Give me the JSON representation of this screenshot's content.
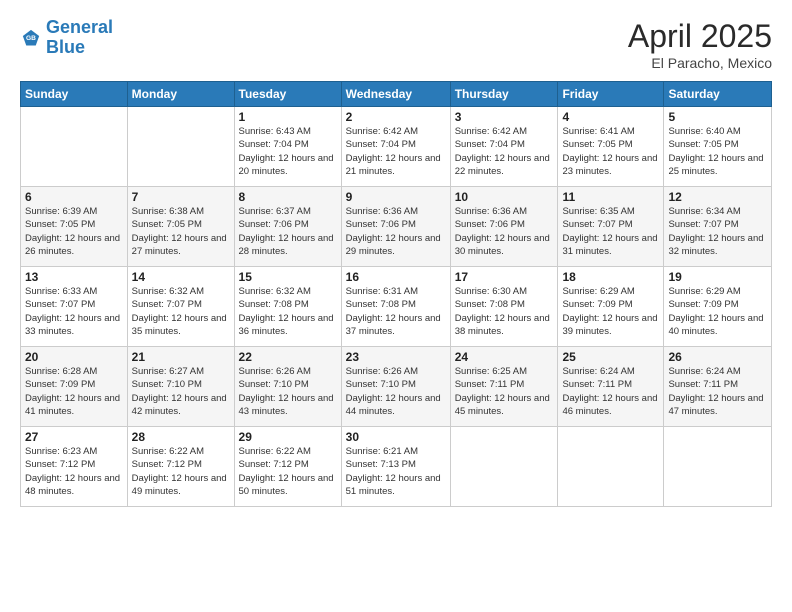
{
  "logo": {
    "line1": "General",
    "line2": "Blue"
  },
  "title": "April 2025",
  "location": "El Paracho, Mexico",
  "days_header": [
    "Sunday",
    "Monday",
    "Tuesday",
    "Wednesday",
    "Thursday",
    "Friday",
    "Saturday"
  ],
  "weeks": [
    [
      {
        "day": "",
        "sunrise": "",
        "sunset": "",
        "daylight": ""
      },
      {
        "day": "",
        "sunrise": "",
        "sunset": "",
        "daylight": ""
      },
      {
        "day": "1",
        "sunrise": "Sunrise: 6:43 AM",
        "sunset": "Sunset: 7:04 PM",
        "daylight": "Daylight: 12 hours and 20 minutes."
      },
      {
        "day": "2",
        "sunrise": "Sunrise: 6:42 AM",
        "sunset": "Sunset: 7:04 PM",
        "daylight": "Daylight: 12 hours and 21 minutes."
      },
      {
        "day": "3",
        "sunrise": "Sunrise: 6:42 AM",
        "sunset": "Sunset: 7:04 PM",
        "daylight": "Daylight: 12 hours and 22 minutes."
      },
      {
        "day": "4",
        "sunrise": "Sunrise: 6:41 AM",
        "sunset": "Sunset: 7:05 PM",
        "daylight": "Daylight: 12 hours and 23 minutes."
      },
      {
        "day": "5",
        "sunrise": "Sunrise: 6:40 AM",
        "sunset": "Sunset: 7:05 PM",
        "daylight": "Daylight: 12 hours and 25 minutes."
      }
    ],
    [
      {
        "day": "6",
        "sunrise": "Sunrise: 6:39 AM",
        "sunset": "Sunset: 7:05 PM",
        "daylight": "Daylight: 12 hours and 26 minutes."
      },
      {
        "day": "7",
        "sunrise": "Sunrise: 6:38 AM",
        "sunset": "Sunset: 7:05 PM",
        "daylight": "Daylight: 12 hours and 27 minutes."
      },
      {
        "day": "8",
        "sunrise": "Sunrise: 6:37 AM",
        "sunset": "Sunset: 7:06 PM",
        "daylight": "Daylight: 12 hours and 28 minutes."
      },
      {
        "day": "9",
        "sunrise": "Sunrise: 6:36 AM",
        "sunset": "Sunset: 7:06 PM",
        "daylight": "Daylight: 12 hours and 29 minutes."
      },
      {
        "day": "10",
        "sunrise": "Sunrise: 6:36 AM",
        "sunset": "Sunset: 7:06 PM",
        "daylight": "Daylight: 12 hours and 30 minutes."
      },
      {
        "day": "11",
        "sunrise": "Sunrise: 6:35 AM",
        "sunset": "Sunset: 7:07 PM",
        "daylight": "Daylight: 12 hours and 31 minutes."
      },
      {
        "day": "12",
        "sunrise": "Sunrise: 6:34 AM",
        "sunset": "Sunset: 7:07 PM",
        "daylight": "Daylight: 12 hours and 32 minutes."
      }
    ],
    [
      {
        "day": "13",
        "sunrise": "Sunrise: 6:33 AM",
        "sunset": "Sunset: 7:07 PM",
        "daylight": "Daylight: 12 hours and 33 minutes."
      },
      {
        "day": "14",
        "sunrise": "Sunrise: 6:32 AM",
        "sunset": "Sunset: 7:07 PM",
        "daylight": "Daylight: 12 hours and 35 minutes."
      },
      {
        "day": "15",
        "sunrise": "Sunrise: 6:32 AM",
        "sunset": "Sunset: 7:08 PM",
        "daylight": "Daylight: 12 hours and 36 minutes."
      },
      {
        "day": "16",
        "sunrise": "Sunrise: 6:31 AM",
        "sunset": "Sunset: 7:08 PM",
        "daylight": "Daylight: 12 hours and 37 minutes."
      },
      {
        "day": "17",
        "sunrise": "Sunrise: 6:30 AM",
        "sunset": "Sunset: 7:08 PM",
        "daylight": "Daylight: 12 hours and 38 minutes."
      },
      {
        "day": "18",
        "sunrise": "Sunrise: 6:29 AM",
        "sunset": "Sunset: 7:09 PM",
        "daylight": "Daylight: 12 hours and 39 minutes."
      },
      {
        "day": "19",
        "sunrise": "Sunrise: 6:29 AM",
        "sunset": "Sunset: 7:09 PM",
        "daylight": "Daylight: 12 hours and 40 minutes."
      }
    ],
    [
      {
        "day": "20",
        "sunrise": "Sunrise: 6:28 AM",
        "sunset": "Sunset: 7:09 PM",
        "daylight": "Daylight: 12 hours and 41 minutes."
      },
      {
        "day": "21",
        "sunrise": "Sunrise: 6:27 AM",
        "sunset": "Sunset: 7:10 PM",
        "daylight": "Daylight: 12 hours and 42 minutes."
      },
      {
        "day": "22",
        "sunrise": "Sunrise: 6:26 AM",
        "sunset": "Sunset: 7:10 PM",
        "daylight": "Daylight: 12 hours and 43 minutes."
      },
      {
        "day": "23",
        "sunrise": "Sunrise: 6:26 AM",
        "sunset": "Sunset: 7:10 PM",
        "daylight": "Daylight: 12 hours and 44 minutes."
      },
      {
        "day": "24",
        "sunrise": "Sunrise: 6:25 AM",
        "sunset": "Sunset: 7:11 PM",
        "daylight": "Daylight: 12 hours and 45 minutes."
      },
      {
        "day": "25",
        "sunrise": "Sunrise: 6:24 AM",
        "sunset": "Sunset: 7:11 PM",
        "daylight": "Daylight: 12 hours and 46 minutes."
      },
      {
        "day": "26",
        "sunrise": "Sunrise: 6:24 AM",
        "sunset": "Sunset: 7:11 PM",
        "daylight": "Daylight: 12 hours and 47 minutes."
      }
    ],
    [
      {
        "day": "27",
        "sunrise": "Sunrise: 6:23 AM",
        "sunset": "Sunset: 7:12 PM",
        "daylight": "Daylight: 12 hours and 48 minutes."
      },
      {
        "day": "28",
        "sunrise": "Sunrise: 6:22 AM",
        "sunset": "Sunset: 7:12 PM",
        "daylight": "Daylight: 12 hours and 49 minutes."
      },
      {
        "day": "29",
        "sunrise": "Sunrise: 6:22 AM",
        "sunset": "Sunset: 7:12 PM",
        "daylight": "Daylight: 12 hours and 50 minutes."
      },
      {
        "day": "30",
        "sunrise": "Sunrise: 6:21 AM",
        "sunset": "Sunset: 7:13 PM",
        "daylight": "Daylight: 12 hours and 51 minutes."
      },
      {
        "day": "",
        "sunrise": "",
        "sunset": "",
        "daylight": ""
      },
      {
        "day": "",
        "sunrise": "",
        "sunset": "",
        "daylight": ""
      },
      {
        "day": "",
        "sunrise": "",
        "sunset": "",
        "daylight": ""
      }
    ]
  ]
}
